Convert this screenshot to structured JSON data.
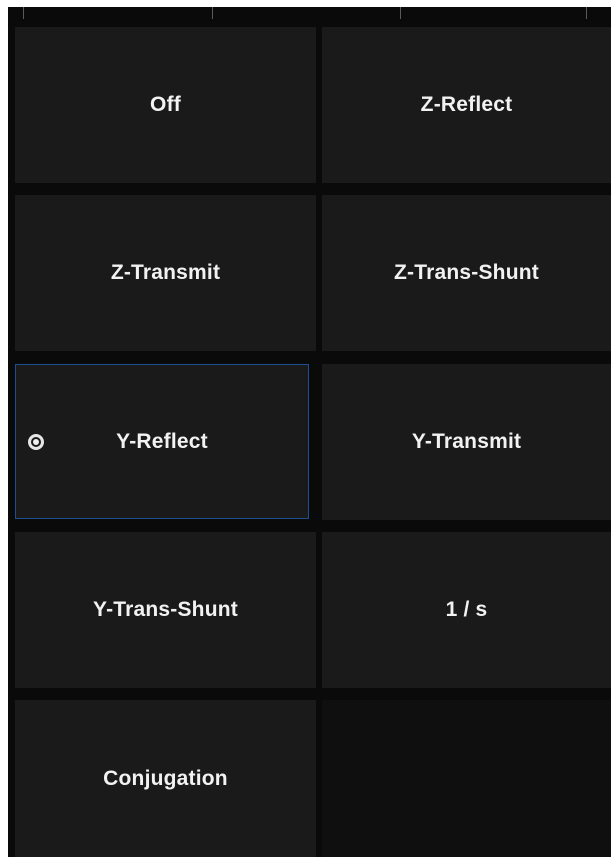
{
  "menu": {
    "buttons": [
      {
        "id": "off",
        "label": "Off"
      },
      {
        "id": "z-reflect",
        "label": "Z-Reflect"
      },
      {
        "id": "z-transmit",
        "label": "Z-Transmit"
      },
      {
        "id": "z-trans-shunt",
        "label": "Z-Trans-Shunt"
      },
      {
        "id": "y-reflect",
        "label": "Y-Reflect",
        "selected": true
      },
      {
        "id": "y-transmit",
        "label": "Y-Transmit"
      },
      {
        "id": "y-trans-shunt",
        "label": "Y-Trans-Shunt"
      },
      {
        "id": "one-over-s",
        "label": "1 / s"
      },
      {
        "id": "conjugation",
        "label": "Conjugation"
      }
    ]
  },
  "colors": {
    "panel_background": "#0a0a0a",
    "button_background": "#1a1a1a",
    "button_text": "#f2f2f2",
    "selected_border": "#1c4f8f"
  }
}
